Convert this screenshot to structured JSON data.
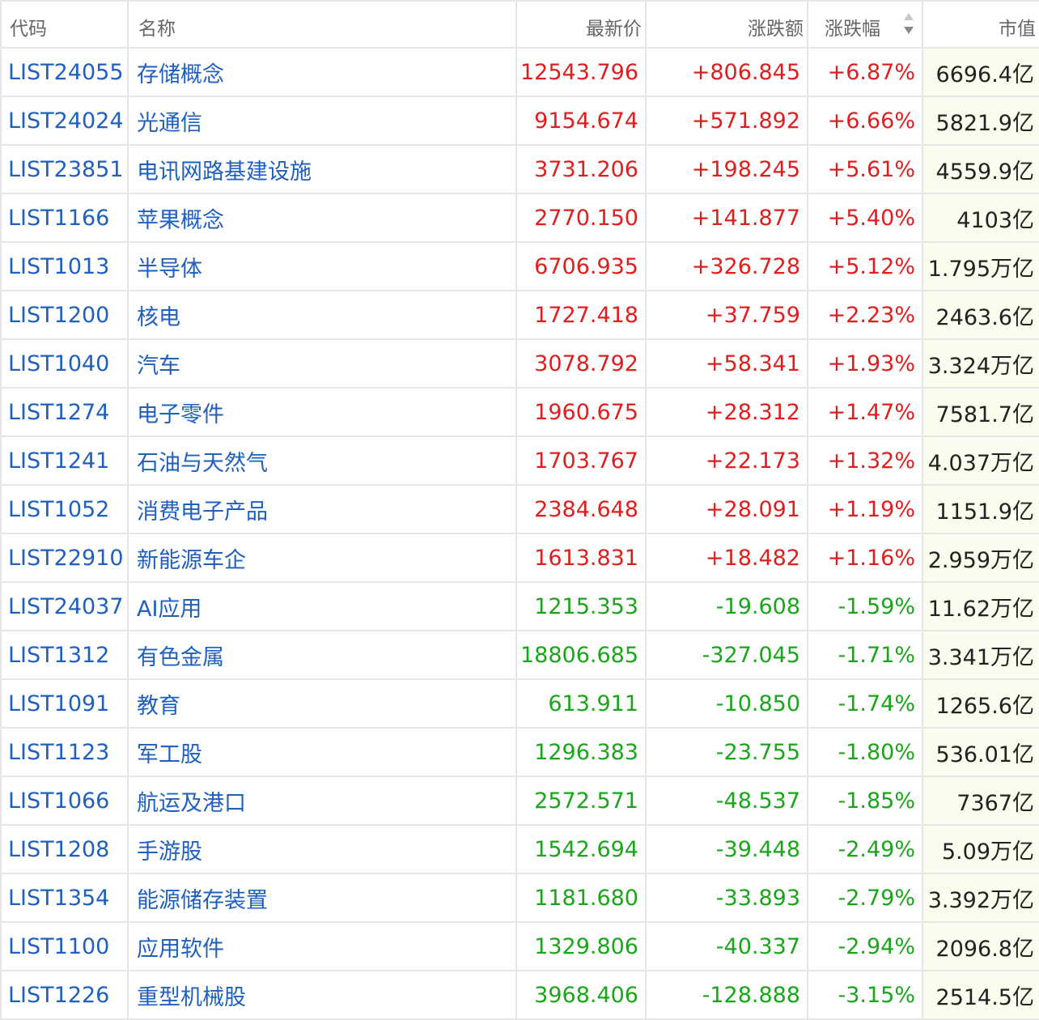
{
  "colors": {
    "up": "#e01e1e",
    "down": "#1aa51a",
    "link": "#1f5fbf",
    "cap_bg": "#fbfbee"
  },
  "headers": {
    "code": "代码",
    "name": "名称",
    "price": "最新价",
    "change": "涨跌额",
    "pct": "涨跌幅",
    "cap": "市值",
    "sort_icon": "sort-desc-icon"
  },
  "rows": [
    {
      "code": "LIST24055",
      "name": "存储概念",
      "price": "12543.796",
      "change": "+806.845",
      "pct": "+6.87%",
      "cap": "6696.4亿",
      "trend": "up"
    },
    {
      "code": "LIST24024",
      "name": "光通信",
      "price": "9154.674",
      "change": "+571.892",
      "pct": "+6.66%",
      "cap": "5821.9亿",
      "trend": "up"
    },
    {
      "code": "LIST23851",
      "name": "电讯网路基建设施",
      "price": "3731.206",
      "change": "+198.245",
      "pct": "+5.61%",
      "cap": "4559.9亿",
      "trend": "up"
    },
    {
      "code": "LIST1166",
      "name": "苹果概念",
      "price": "2770.150",
      "change": "+141.877",
      "pct": "+5.40%",
      "cap": "4103亿",
      "trend": "up"
    },
    {
      "code": "LIST1013",
      "name": "半导体",
      "price": "6706.935",
      "change": "+326.728",
      "pct": "+5.12%",
      "cap": "1.795万亿",
      "trend": "up"
    },
    {
      "code": "LIST1200",
      "name": "核电",
      "price": "1727.418",
      "change": "+37.759",
      "pct": "+2.23%",
      "cap": "2463.6亿",
      "trend": "up"
    },
    {
      "code": "LIST1040",
      "name": "汽车",
      "price": "3078.792",
      "change": "+58.341",
      "pct": "+1.93%",
      "cap": "3.324万亿",
      "trend": "up"
    },
    {
      "code": "LIST1274",
      "name": "电子零件",
      "price": "1960.675",
      "change": "+28.312",
      "pct": "+1.47%",
      "cap": "7581.7亿",
      "trend": "up"
    },
    {
      "code": "LIST1241",
      "name": "石油与天然气",
      "price": "1703.767",
      "change": "+22.173",
      "pct": "+1.32%",
      "cap": "4.037万亿",
      "trend": "up"
    },
    {
      "code": "LIST1052",
      "name": "消费电子产品",
      "price": "2384.648",
      "change": "+28.091",
      "pct": "+1.19%",
      "cap": "1151.9亿",
      "trend": "up"
    },
    {
      "code": "LIST22910",
      "name": "新能源车企",
      "price": "1613.831",
      "change": "+18.482",
      "pct": "+1.16%",
      "cap": "2.959万亿",
      "trend": "up"
    },
    {
      "code": "LIST24037",
      "name": "AI应用",
      "price": "1215.353",
      "change": "-19.608",
      "pct": "-1.59%",
      "cap": "11.62万亿",
      "trend": "down"
    },
    {
      "code": "LIST1312",
      "name": "有色金属",
      "price": "18806.685",
      "change": "-327.045",
      "pct": "-1.71%",
      "cap": "3.341万亿",
      "trend": "down"
    },
    {
      "code": "LIST1091",
      "name": "教育",
      "price": "613.911",
      "change": "-10.850",
      "pct": "-1.74%",
      "cap": "1265.6亿",
      "trend": "down"
    },
    {
      "code": "LIST1123",
      "name": "军工股",
      "price": "1296.383",
      "change": "-23.755",
      "pct": "-1.80%",
      "cap": "536.01亿",
      "trend": "down"
    },
    {
      "code": "LIST1066",
      "name": "航运及港口",
      "price": "2572.571",
      "change": "-48.537",
      "pct": "-1.85%",
      "cap": "7367亿",
      "trend": "down"
    },
    {
      "code": "LIST1208",
      "name": "手游股",
      "price": "1542.694",
      "change": "-39.448",
      "pct": "-2.49%",
      "cap": "5.09万亿",
      "trend": "down"
    },
    {
      "code": "LIST1354",
      "name": "能源储存装置",
      "price": "1181.680",
      "change": "-33.893",
      "pct": "-2.79%",
      "cap": "3.392万亿",
      "trend": "down"
    },
    {
      "code": "LIST1100",
      "name": "应用软件",
      "price": "1329.806",
      "change": "-40.337",
      "pct": "-2.94%",
      "cap": "2096.8亿",
      "trend": "down"
    },
    {
      "code": "LIST1226",
      "name": "重型机械股",
      "price": "3968.406",
      "change": "-128.888",
      "pct": "-3.15%",
      "cap": "2514.5亿",
      "trend": "down"
    }
  ]
}
